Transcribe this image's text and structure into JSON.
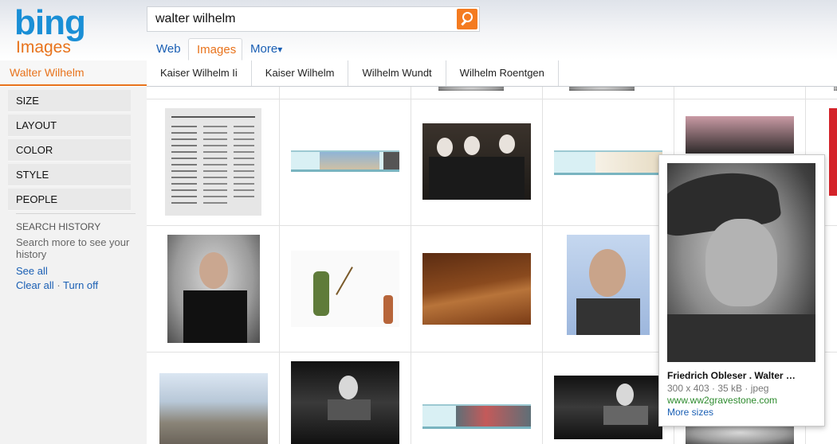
{
  "brand": {
    "logo_text": "bing",
    "vertical_label": "Images"
  },
  "search": {
    "query": "walter wilhelm",
    "button_icon": "search-icon"
  },
  "scopes": [
    {
      "label": "Web",
      "active": false
    },
    {
      "label": "Images",
      "active": true
    },
    {
      "label": "More",
      "caret": "▾",
      "active": false
    }
  ],
  "query_label": "Walter Wilhelm",
  "related_searches": [
    "Kaiser Wilhelm Ii",
    "Kaiser Wilhelm",
    "Wilhelm Wundt",
    "Wilhelm Roentgen"
  ],
  "filters": [
    "SIZE",
    "LAYOUT",
    "COLOR",
    "STYLE",
    "PEOPLE"
  ],
  "search_history": {
    "title": "SEARCH HISTORY",
    "note": "Search more to see your history",
    "see_all": "See all",
    "clear_all": "Clear all",
    "separator": "·",
    "turn_off": "Turn off"
  },
  "preview": {
    "title": "Friedrich Obleser . Walter …",
    "meta": "300 x 403 · 35 kB · jpeg",
    "url": "www.ww2gravestone.com",
    "more_sizes": "More sizes"
  },
  "colors": {
    "accent": "#e8731c",
    "link": "#1a5fb4",
    "brand_blue": "#1a8fd6",
    "url_green": "#2e8b2e"
  }
}
